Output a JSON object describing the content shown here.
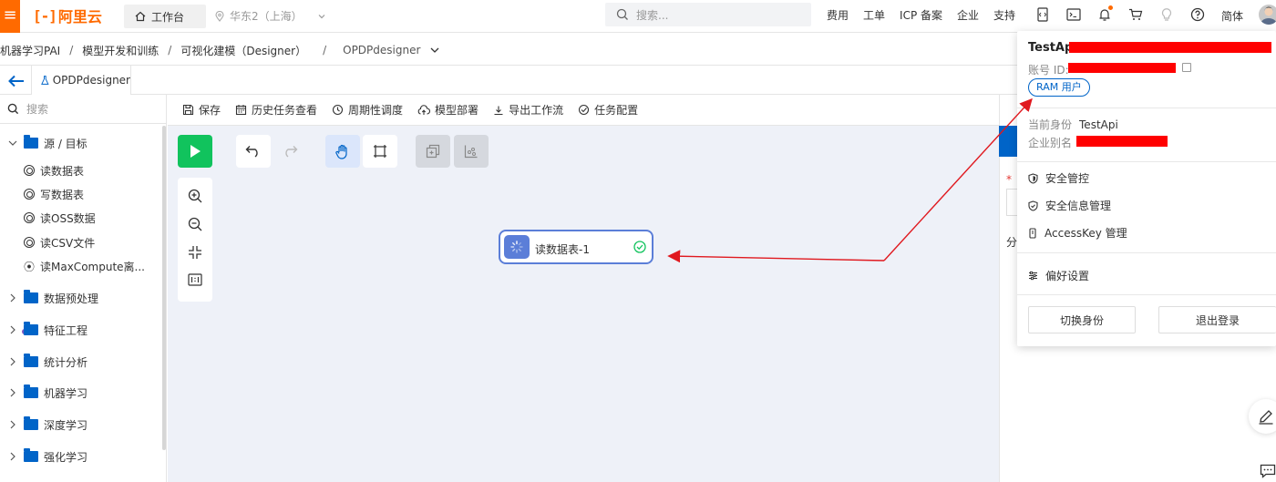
{
  "header": {
    "logo_mark": "[-]",
    "logo_text": "阿里云",
    "workbench_label": "工作台",
    "region_label": "华东2（上海）",
    "search_placeholder": "搜索...",
    "nav_links": [
      "费用",
      "工单",
      "ICP 备案",
      "企业",
      "支持"
    ],
    "language": "简体",
    "accent_color": "#ff6a00"
  },
  "breadcrumb": {
    "items": [
      "机器学习PAI",
      "模型开发和训练",
      "可视化建模（Designer）",
      "OPDPdesigner"
    ],
    "separator": "/"
  },
  "tabs": {
    "active_tab": "OPDPdesigner"
  },
  "sidebar": {
    "search_placeholder": "搜索",
    "groups": [
      {
        "label": "源 / 目标",
        "expanded": true,
        "items": [
          "读数据表",
          "写数据表",
          "读OSS数据",
          "读CSV文件",
          "读MaxCompute离..."
        ]
      },
      {
        "label": "数据预处理",
        "expanded": false
      },
      {
        "label": "特征工程",
        "expanded": false
      },
      {
        "label": "统计分析",
        "expanded": false
      },
      {
        "label": "机器学习",
        "expanded": false
      },
      {
        "label": "深度学习",
        "expanded": false
      },
      {
        "label": "强化学习",
        "expanded": false
      }
    ]
  },
  "toolbar": {
    "items": [
      "保存",
      "历史任务查看",
      "周期性调度",
      "模型部署",
      "导出工作流",
      "任务配置"
    ]
  },
  "canvas": {
    "node_label": "读数据表-1",
    "node_status": "success",
    "run_color": "#11c35d",
    "node_color": "#5b7ed8"
  },
  "right_panel": {
    "required_mark": "*",
    "partial_label": "分"
  },
  "account_popup": {
    "user_name": "TestApi",
    "account_id_label": "账号 ID:",
    "ram_badge": "RAM 用户",
    "current_identity_label": "当前身份",
    "current_identity_value": "TestApi",
    "enterprise_alias_label": "企业别名",
    "menu": [
      "安全管控",
      "安全信息管理",
      "AccessKey 管理"
    ],
    "preferences": "偏好设置",
    "switch_identity": "切换身份",
    "logout": "退出登录",
    "redaction_color": "#ff0000"
  }
}
